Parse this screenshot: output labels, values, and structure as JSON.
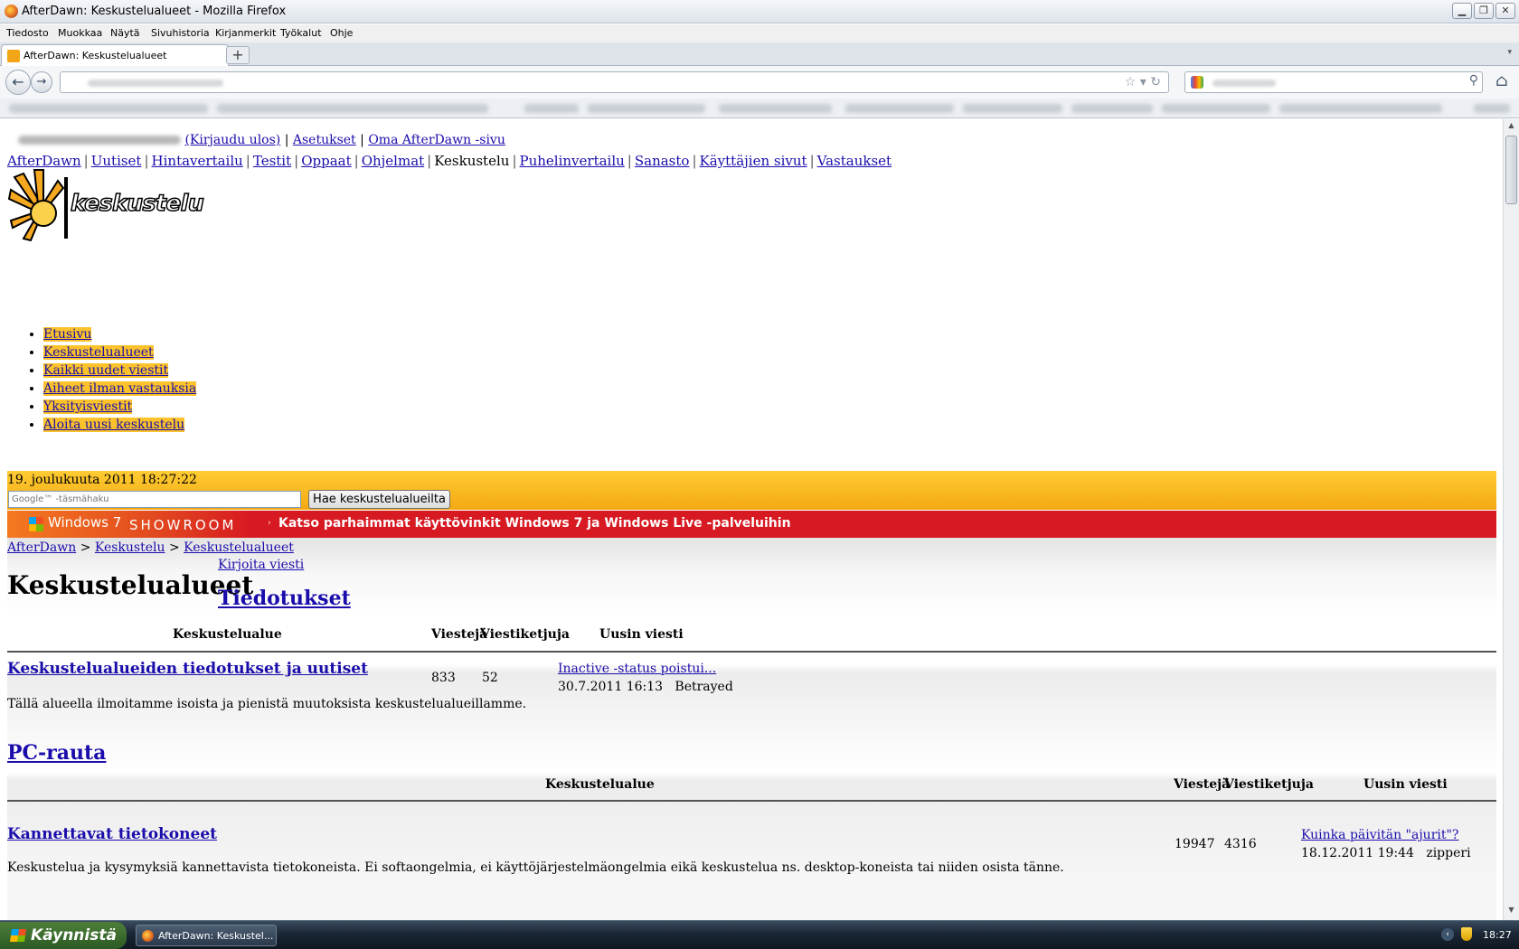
{
  "window": {
    "title": "AfterDawn: Keskustelualueet - Mozilla Firefox",
    "controls": {
      "minimize": "▁",
      "maximize": "❐",
      "close": "✕"
    }
  },
  "menubar": [
    "Tiedosto",
    "Muokkaa",
    "Näytä",
    "Sivuhistoria",
    "Kirjanmerkit",
    "Työkalut",
    "Ohje"
  ],
  "tab": {
    "title": "AfterDawn: Keskustelualueet",
    "new_tab": "+",
    "list": "▾"
  },
  "nav": {
    "back": "←",
    "forward": "→",
    "home": "⌂",
    "url_controls": "☆ ▾ ↻",
    "search_icon": "⚲"
  },
  "page": {
    "user": {
      "logout": "(Kirjaudu ulos)",
      "sep": "|",
      "settings": "Asetukset",
      "own_page": "Oma AfterDawn -sivu"
    },
    "topnav": [
      "AfterDawn",
      "Uutiset",
      "Hintavertailu",
      "Testit",
      "Oppaat",
      "Ohjelmat",
      "Keskustelu",
      "Puhelinvertailu",
      "Sanasto",
      "Käyttäjien sivut",
      "Vastaukset"
    ],
    "topnav_active": "Keskustelu",
    "topnav_sep": "|",
    "logo_text": "keskustelu",
    "sidemenu": [
      "Etusivu",
      "Keskustelualueet",
      "Kaikki uudet viestit",
      "Aiheet ilman vastauksia",
      "Yksityisviestit",
      "Aloita uusi keskustelu"
    ],
    "date": "19. joulukuuta 2011 18:27:22",
    "search_placeholder": "Google™ -täsmähaku",
    "search_button": "Hae keskustelualueilta",
    "banner": {
      "brand": "Windows 7",
      "showroom": "SHOWROOM",
      "arrow": "›",
      "message": "Katso parhaimmat käyttövinkit Windows 7 ja Windows Live -palveluihin"
    },
    "breadcrumb": {
      "items": [
        "AfterDawn",
        "Keskustelu",
        "Keskustelualueet"
      ],
      "sep": ">"
    },
    "write_link": "Kirjoita viesti",
    "title": "Keskustelualueet",
    "columns": {
      "area": "Keskustelualue",
      "posts": "Viestejä",
      "threads": "Viestiketjuja",
      "latest": "Uusin viesti"
    },
    "sections": [
      {
        "title": "Tiedotukset",
        "forums": [
          {
            "name": "Keskustelualueiden tiedotukset ja uutiset",
            "desc": "Tällä alueella ilmoitamme isoista ja pienistä muutoksista keskustelualueillamme.",
            "posts": "833",
            "threads": "52",
            "latest_title": "Inactive -status poistui...",
            "latest_date": "30.7.2011 16:13",
            "latest_user": "Betrayed"
          }
        ]
      },
      {
        "title": "PC-rauta",
        "forums": [
          {
            "name": "Kannettavat tietokoneet",
            "desc": "Keskustelua ja kysymyksiä kannettavista tietokoneista. Ei softaongelmia, ei käyttöjärjestelmäongelmia eikä keskustelua ns. desktop-koneista tai niiden osista tänne.",
            "posts": "19947",
            "threads": "4316",
            "latest_title": "Kuinka päivitän \"ajurit\"?",
            "latest_date": "18.12.2011 19:44",
            "latest_user": "zipperi"
          }
        ]
      }
    ]
  },
  "taskbar": {
    "start": "Käynnistä",
    "item": "AfterDawn: Keskustel...",
    "clock": "18:27",
    "tray_chevron": "‹"
  },
  "colors": {
    "link": "#1a0dab",
    "datebar": "#f9b91f",
    "banner": "#d71921",
    "menu_highlight": "#fbc22b"
  }
}
